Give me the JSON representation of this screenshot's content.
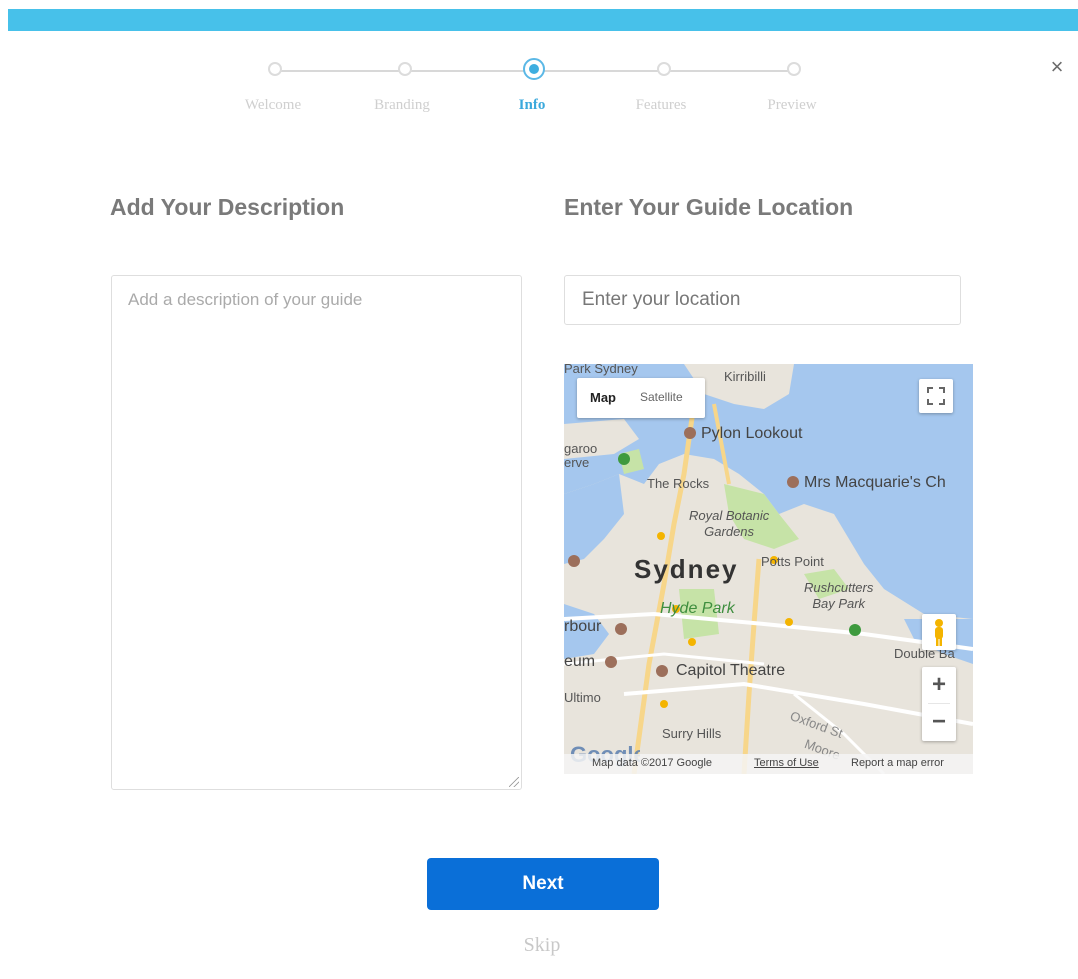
{
  "close_icon_label": "×",
  "steps": [
    {
      "label": "Welcome",
      "active": false
    },
    {
      "label": "Branding",
      "active": false
    },
    {
      "label": "Info",
      "active": true
    },
    {
      "label": "Features",
      "active": false
    },
    {
      "label": "Preview",
      "active": false
    }
  ],
  "description": {
    "title": "Add Your Description",
    "placeholder": "Add a description of your guide"
  },
  "location": {
    "title": "Enter Your Guide Location",
    "placeholder": "Enter your location"
  },
  "map": {
    "type_map": "Map",
    "type_satellite": "Satellite",
    "labels": {
      "park_sydney": "Park Sydney",
      "kirribilli": "Kirribilli",
      "pylon_lookout": "Pylon Lookout",
      "garoo_erve": "garoo\nerve",
      "the_rocks": "The Rocks",
      "mrs_macquarie": "Mrs Macquarie's Ch",
      "royal_botanic": "Royal Botanic\nGardens",
      "sydney": "Sydney",
      "potts_point": "Potts Point",
      "rushcutters": "Rushcutters\nBay Park",
      "hyde_park": "Hyde Park",
      "harbour": "rbour",
      "museum": "eum",
      "capitol_theatre": "Capitol Theatre",
      "double_bay": "Double Ba",
      "ultimo": "Ultimo",
      "surry_hills": "Surry Hills",
      "oxford_st": "Oxford St",
      "moore": "Moore"
    },
    "zoom_in": "+",
    "zoom_out": "−",
    "attribution": {
      "data": "Map data ©2017 Google",
      "terms": "Terms of Use",
      "report": "Report a map error"
    },
    "colors": {
      "water": "#a5c7ee",
      "land": "#e8e4dc",
      "park": "#c6e3a7",
      "road": "#f7d68a"
    }
  },
  "buttons": {
    "next": "Next",
    "skip": "Skip"
  }
}
